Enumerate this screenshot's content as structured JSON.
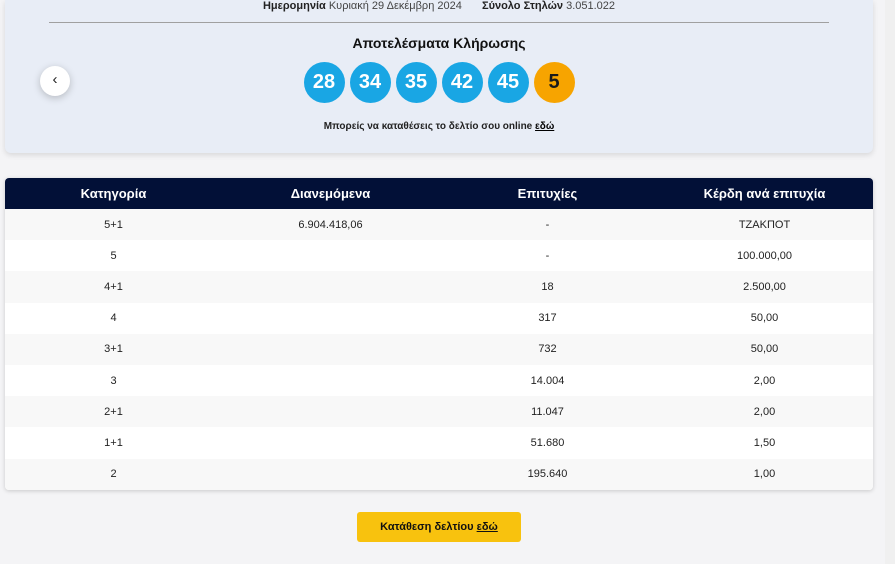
{
  "header": {
    "date_label": "Ημερομηνία",
    "date_value": "Κυριακή 29 Δεκέμβρη 2024",
    "total_label": "Σύνολο Στηλών",
    "total_value": "3.051.022"
  },
  "draw": {
    "title": "Αποτελέσματα Κλήρωσης",
    "numbers": [
      "28",
      "34",
      "35",
      "42",
      "45"
    ],
    "bonus": "5",
    "prev_icon": "chevron-left-icon",
    "prev_glyph": "‹",
    "note_text": "Μπορείς να καταθέσεις το δελτίο σου online ",
    "note_link": "εδώ"
  },
  "table": {
    "headers": [
      "Κατηγορία",
      "Διανεμόμενα",
      "Επιτυχίες",
      "Κέρδη ανά επιτυχία"
    ],
    "rows": [
      [
        "5+1",
        "6.904.418,06",
        "-",
        "ΤΖΑΚΠΟΤ"
      ],
      [
        "5",
        "",
        "-",
        "100.000,00"
      ],
      [
        "4+1",
        "",
        "18",
        "2.500,00"
      ],
      [
        "4",
        "",
        "317",
        "50,00"
      ],
      [
        "3+1",
        "",
        "732",
        "50,00"
      ],
      [
        "3",
        "",
        "14.004",
        "2,00"
      ],
      [
        "2+1",
        "",
        "11.047",
        "2,00"
      ],
      [
        "1+1",
        "",
        "51.680",
        "1,50"
      ],
      [
        "2",
        "",
        "195.640",
        "1,00"
      ]
    ]
  },
  "cta": {
    "text": "Κατάθεση δελτίου ",
    "link": "εδώ"
  },
  "colors": {
    "ball": "#19a6e4",
    "bonus_ball": "#f7a400",
    "table_header": "#021037",
    "cta": "#f8c20e"
  }
}
